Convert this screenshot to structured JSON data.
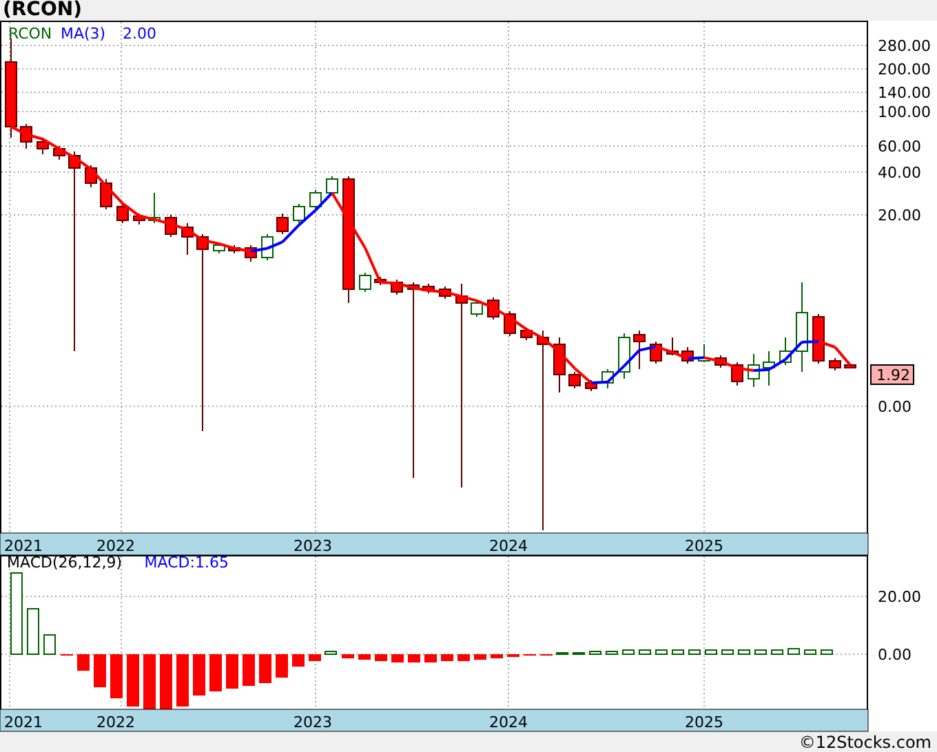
{
  "title": "(RCON)",
  "price_panel": {
    "legend": [
      {
        "kind": "symbol",
        "text": "RCON"
      },
      {
        "kind": "indicator",
        "text": "MA(3)"
      },
      {
        "kind": "indicator",
        "text": "2.00"
      }
    ],
    "y_ticks": [
      "280.00",
      "200.00",
      "140.00",
      "100.00",
      "60.00",
      "40.00",
      "20.00",
      "0.00"
    ],
    "last_price": "1.92",
    "years": [
      "2021",
      "2022",
      "2023",
      "2024",
      "2025"
    ]
  },
  "macd_panel": {
    "legend": [
      {
        "kind": "name",
        "text": "MACD(26,12,9)"
      },
      {
        "kind": "value",
        "text": "MACD:1.65"
      }
    ],
    "y_ticks": [
      "20.00",
      "0.00"
    ],
    "years": [
      "2021",
      "2022",
      "2023",
      "2024",
      "2025"
    ]
  },
  "footer": "©12Stocks.com"
}
